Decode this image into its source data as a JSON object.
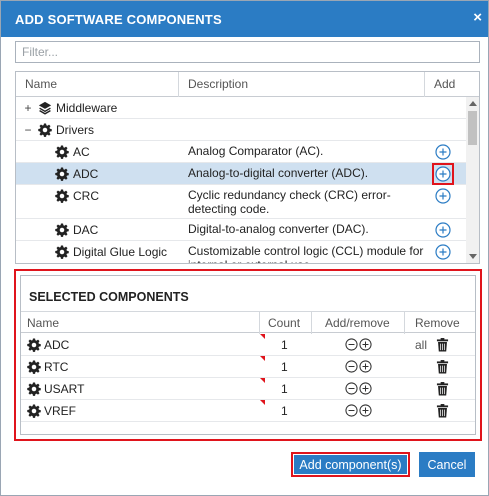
{
  "dialog": {
    "title": "ADD SOFTWARE COMPONENTS",
    "close_glyph": "×"
  },
  "filter": {
    "placeholder": "Filter...",
    "value": ""
  },
  "available": {
    "columns": {
      "name": "Name",
      "description": "Description",
      "add": "Add"
    },
    "rows": [
      {
        "toggle": "+",
        "icon": "layers-icon",
        "name": "Middleware",
        "description": ""
      },
      {
        "toggle": "−",
        "icon": "gear-icon",
        "name": "Drivers",
        "description": ""
      },
      {
        "icon": "gear-icon",
        "name": "AC",
        "description": "Analog Comparator (AC)."
      },
      {
        "icon": "gear-icon",
        "name": "ADC",
        "description": "Analog-to-digital converter (ADC).",
        "selected": true
      },
      {
        "icon": "gear-icon",
        "name": "CRC",
        "description": "Cyclic redundancy check (CRC) error-detecting code."
      },
      {
        "icon": "gear-icon",
        "name": "DAC",
        "description": "Digital-to-analog converter (DAC)."
      },
      {
        "icon": "gear-icon",
        "name": "Digital Glue Logic",
        "description": "Customizable control logic (CCL) module for internal or external use."
      }
    ]
  },
  "selected": {
    "title": "SELECTED COMPONENTS",
    "columns": {
      "name": "Name",
      "count": "Count",
      "add_remove": "Add/remove",
      "remove_all": "Remove all"
    },
    "rows": [
      {
        "name": "ADC",
        "count": "1"
      },
      {
        "name": "RTC",
        "count": "1"
      },
      {
        "name": "USART",
        "count": "1"
      },
      {
        "name": "VREF",
        "count": "1"
      }
    ]
  },
  "buttons": {
    "add": "Add component(s)",
    "cancel": "Cancel"
  },
  "colors": {
    "accent": "#2b7cc4",
    "highlight": "#e0141c",
    "selected_row": "#cfe0f0"
  }
}
